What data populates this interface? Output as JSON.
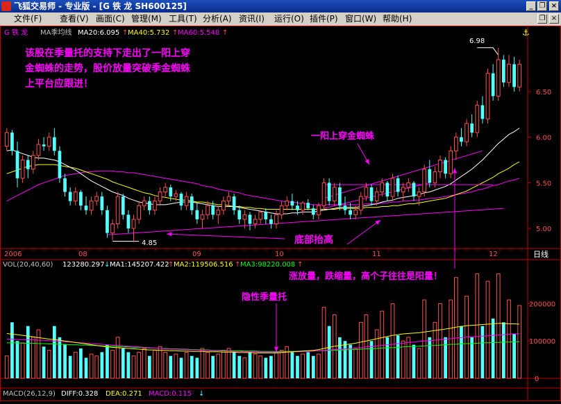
{
  "window": {
    "title": "飞狐交易师 - 专业版 - [G 铁 龙 SH600125]",
    "minimize": "_",
    "restore": "❐",
    "close": "×"
  },
  "menu": {
    "items": [
      "文件(F)",
      "查看(V)",
      "画面(C)",
      "管理(M)",
      "工具(T)",
      "分析(A)",
      "资讯(I)",
      "运行(O)",
      "插件(P)",
      "窗口(W)",
      "帮助(H)"
    ],
    "restore": "❐",
    "close": "×"
  },
  "price_header": {
    "stock": "G 铁   龙",
    "indicator": "MA季均线",
    "ma20": "MA20:6.095",
    "ma40": "MA40:5.732",
    "ma60": "MA60:5.548",
    "arrow": "↑"
  },
  "colors": {
    "up": "#ff5050",
    "down": "#54ffff",
    "ma20": "#ffffff",
    "ma40": "#ffff00",
    "ma60": "#ff00ff",
    "annotation": "#ff00ff",
    "axis": "#c00000",
    "vol_ma3": "#00ff00"
  },
  "annotations": {
    "main_text": [
      "该股在季量托的支持下走出了一阳上穿",
      "金蜘蛛的走势，股价放量突破季金蜘蛛",
      "上平台应跟进！"
    ],
    "one_yang": "一阳上穿金蜘蛛",
    "bottom_rise": "底部抬高",
    "vol_text": "涨放量，跌缩量，高个子往往是阳量！",
    "hidden_tuo": "隐性季量托"
  },
  "price_labels": {
    "high": "6.98",
    "low": "4.85"
  },
  "time_axis": {
    "labels": [
      "2006",
      "08",
      "09",
      "10",
      "11",
      "12"
    ],
    "period": "日线"
  },
  "volume_header": {
    "label": "VOL(20,40,60)",
    "value": "123280.297",
    "ma1": "MA1:145207.422",
    "ma2": "MA2:119506.516",
    "ma3": "MA3:98220.008",
    "down_arrow": "↓",
    "up_arrow": "↑"
  },
  "macd_header": {
    "label": "MACD(26,12,9)",
    "diff": "DIFF:0.328",
    "dea": "DEA:0.271",
    "macd": "MACD:0.115",
    "arrow": "↓"
  },
  "chart_data": {
    "type": "candlestick",
    "price_ticks": [
      5.0,
      5.5,
      6.0,
      6.5
    ],
    "price_ylim": [
      4.78,
      7.1
    ],
    "volume_ticks": [
      0,
      100000,
      200000
    ],
    "volume_tick_labels": [
      "0",
      "100000",
      "200000"
    ],
    "volume_ylim": [
      0,
      290000
    ],
    "ohlc": [
      [
        5.9,
        6.1,
        5.85,
        6.05
      ],
      [
        6.05,
        6.08,
        5.8,
        5.85
      ],
      [
        5.85,
        5.95,
        5.45,
        5.55
      ],
      [
        5.55,
        5.8,
        5.5,
        5.75
      ],
      [
        5.75,
        5.8,
        5.55,
        5.65
      ],
      [
        5.65,
        5.85,
        5.6,
        5.8
      ],
      [
        5.8,
        5.98,
        5.75,
        5.92
      ],
      [
        5.92,
        6.0,
        5.85,
        5.9
      ],
      [
        5.9,
        6.05,
        5.85,
        6.0
      ],
      [
        6.0,
        6.1,
        5.8,
        5.85
      ],
      [
        5.85,
        5.9,
        5.5,
        5.55
      ],
      [
        5.55,
        5.6,
        5.35,
        5.4
      ],
      [
        5.4,
        5.45,
        5.25,
        5.3
      ],
      [
        5.3,
        5.45,
        5.25,
        5.4
      ],
      [
        5.4,
        5.42,
        5.2,
        5.25
      ],
      [
        5.25,
        5.35,
        5.15,
        5.2
      ],
      [
        5.2,
        5.35,
        5.15,
        5.3
      ],
      [
        5.3,
        5.4,
        5.25,
        5.35
      ],
      [
        5.35,
        5.4,
        5.15,
        5.2
      ],
      [
        5.2,
        5.25,
        4.9,
        4.95
      ],
      [
        4.95,
        5.1,
        4.87,
        5.05
      ],
      [
        5.05,
        5.4,
        5.0,
        5.35
      ],
      [
        5.35,
        5.38,
        5.1,
        5.15
      ],
      [
        5.15,
        5.2,
        4.95,
        5.0
      ],
      [
        5.0,
        5.15,
        4.85,
        5.1
      ],
      [
        5.1,
        5.3,
        5.05,
        5.25
      ],
      [
        5.25,
        5.35,
        5.2,
        5.3
      ],
      [
        5.3,
        5.35,
        5.15,
        5.2
      ],
      [
        5.2,
        5.35,
        5.15,
        5.3
      ],
      [
        5.3,
        5.45,
        5.25,
        5.4
      ],
      [
        5.4,
        5.5,
        5.35,
        5.45
      ],
      [
        5.45,
        5.48,
        5.3,
        5.35
      ],
      [
        5.35,
        5.42,
        5.3,
        5.38
      ],
      [
        5.38,
        5.4,
        5.2,
        5.25
      ],
      [
        5.25,
        5.4,
        5.2,
        5.35
      ],
      [
        5.35,
        5.38,
        5.15,
        5.2
      ],
      [
        5.2,
        5.28,
        5.05,
        5.1
      ],
      [
        5.1,
        5.2,
        5.0,
        5.15
      ],
      [
        5.15,
        5.3,
        5.1,
        5.25
      ],
      [
        5.25,
        5.3,
        5.1,
        5.15
      ],
      [
        5.15,
        5.25,
        5.05,
        5.2
      ],
      [
        5.2,
        5.35,
        5.15,
        5.3
      ],
      [
        5.3,
        5.4,
        5.25,
        5.35
      ],
      [
        5.35,
        5.38,
        5.15,
        5.2
      ],
      [
        5.2,
        5.25,
        5.05,
        5.1
      ],
      [
        5.1,
        5.2,
        5.0,
        5.15
      ],
      [
        5.15,
        5.18,
        4.98,
        5.05
      ],
      [
        5.05,
        5.15,
        5.0,
        5.1
      ],
      [
        5.1,
        5.2,
        5.05,
        5.18
      ],
      [
        5.18,
        5.22,
        5.05,
        5.1
      ],
      [
        5.1,
        5.15,
        5.0,
        5.05
      ],
      [
        5.05,
        5.2,
        5.0,
        5.15
      ],
      [
        5.15,
        5.3,
        5.1,
        5.25
      ],
      [
        5.25,
        5.35,
        5.2,
        5.3
      ],
      [
        5.3,
        5.38,
        5.2,
        5.25
      ],
      [
        5.25,
        5.3,
        5.15,
        5.2
      ],
      [
        5.2,
        5.3,
        5.15,
        5.28
      ],
      [
        5.28,
        5.32,
        5.2,
        5.22
      ],
      [
        5.22,
        5.26,
        5.1,
        5.15
      ],
      [
        5.15,
        5.28,
        5.1,
        5.25
      ],
      [
        5.25,
        5.55,
        5.2,
        5.5
      ],
      [
        5.5,
        5.55,
        5.25,
        5.3
      ],
      [
        5.3,
        5.5,
        5.25,
        5.45
      ],
      [
        5.45,
        5.5,
        5.2,
        5.25
      ],
      [
        5.25,
        5.35,
        5.15,
        5.2
      ],
      [
        5.2,
        5.28,
        5.1,
        5.15
      ],
      [
        5.15,
        5.25,
        5.1,
        5.2
      ],
      [
        5.2,
        5.4,
        5.15,
        5.35
      ],
      [
        5.35,
        5.5,
        5.3,
        5.45
      ],
      [
        5.45,
        5.48,
        5.25,
        5.3
      ],
      [
        5.3,
        5.45,
        5.25,
        5.4
      ],
      [
        5.4,
        5.55,
        5.35,
        5.5
      ],
      [
        5.5,
        5.52,
        5.3,
        5.35
      ],
      [
        5.35,
        5.6,
        5.3,
        5.55
      ],
      [
        5.55,
        5.58,
        5.35,
        5.4
      ],
      [
        5.4,
        5.5,
        5.3,
        5.45
      ],
      [
        5.45,
        5.55,
        5.4,
        5.5
      ],
      [
        5.5,
        5.52,
        5.3,
        5.35
      ],
      [
        5.35,
        5.45,
        5.25,
        5.4
      ],
      [
        5.4,
        5.7,
        5.35,
        5.65
      ],
      [
        5.65,
        5.75,
        5.45,
        5.5
      ],
      [
        5.5,
        5.68,
        5.45,
        5.62
      ],
      [
        5.62,
        5.8,
        5.55,
        5.75
      ],
      [
        5.75,
        5.78,
        5.55,
        5.6
      ],
      [
        5.6,
        5.9,
        5.55,
        5.85
      ],
      [
        5.85,
        6.05,
        5.75,
        6.0
      ],
      [
        6.0,
        6.1,
        5.9,
        5.95
      ],
      [
        5.95,
        6.2,
        5.9,
        6.15
      ],
      [
        6.15,
        6.25,
        6.0,
        6.05
      ],
      [
        6.05,
        6.4,
        6.0,
        6.35
      ],
      [
        6.35,
        6.45,
        6.15,
        6.2
      ],
      [
        6.2,
        6.75,
        6.15,
        6.7
      ],
      [
        6.7,
        6.8,
        6.4,
        6.45
      ],
      [
        6.45,
        6.98,
        6.4,
        6.85
      ],
      [
        6.85,
        6.9,
        6.55,
        6.6
      ],
      [
        6.6,
        6.9,
        6.55,
        6.8
      ],
      [
        6.8,
        6.88,
        6.5,
        6.55
      ],
      [
        6.55,
        6.85,
        6.5,
        6.8
      ]
    ],
    "ma20": [
      5.85,
      5.86,
      5.84,
      5.82,
      5.8,
      5.78,
      5.77,
      5.77,
      5.76,
      5.75,
      5.73,
      5.7,
      5.67,
      5.64,
      5.6,
      5.56,
      5.52,
      5.49,
      5.46,
      5.43,
      5.4,
      5.38,
      5.36,
      5.33,
      5.31,
      5.29,
      5.28,
      5.27,
      5.26,
      5.26,
      5.26,
      5.27,
      5.28,
      5.29,
      5.29,
      5.29,
      5.28,
      5.27,
      5.26,
      5.25,
      5.24,
      5.24,
      5.24,
      5.24,
      5.23,
      5.22,
      5.21,
      5.2,
      5.19,
      5.18,
      5.17,
      5.16,
      5.16,
      5.16,
      5.17,
      5.17,
      5.18,
      5.18,
      5.18,
      5.19,
      5.2,
      5.21,
      5.22,
      5.23,
      5.23,
      5.23,
      5.23,
      5.24,
      5.25,
      5.26,
      5.27,
      5.29,
      5.3,
      5.31,
      5.33,
      5.34,
      5.35,
      5.36,
      5.37,
      5.39,
      5.4,
      5.42,
      5.44,
      5.46,
      5.49,
      5.53,
      5.57,
      5.61,
      5.65,
      5.7,
      5.75,
      5.81,
      5.87,
      5.93,
      5.98,
      6.03,
      6.06,
      6.1
    ],
    "ma40": [
      5.6,
      5.62,
      5.64,
      5.66,
      5.68,
      5.69,
      5.7,
      5.7,
      5.7,
      5.7,
      5.69,
      5.68,
      5.67,
      5.66,
      5.64,
      5.62,
      5.6,
      5.58,
      5.56,
      5.54,
      5.51,
      5.49,
      5.47,
      5.45,
      5.43,
      5.41,
      5.39,
      5.38,
      5.36,
      5.35,
      5.34,
      5.33,
      5.32,
      5.31,
      5.31,
      5.3,
      5.29,
      5.29,
      5.28,
      5.27,
      5.26,
      5.26,
      5.25,
      5.24,
      5.24,
      5.23,
      5.23,
      5.22,
      5.22,
      5.21,
      5.21,
      5.21,
      5.21,
      5.21,
      5.21,
      5.21,
      5.21,
      5.21,
      5.21,
      5.21,
      5.21,
      5.21,
      5.21,
      5.22,
      5.22,
      5.22,
      5.22,
      5.22,
      5.23,
      5.23,
      5.23,
      5.24,
      5.24,
      5.25,
      5.25,
      5.26,
      5.27,
      5.27,
      5.28,
      5.29,
      5.3,
      5.31,
      5.32,
      5.33,
      5.35,
      5.37,
      5.39,
      5.41,
      5.44,
      5.47,
      5.5,
      5.53,
      5.56,
      5.6,
      5.63,
      5.66,
      5.7,
      5.73
    ],
    "ma60": [
      5.3,
      5.33,
      5.36,
      5.39,
      5.42,
      5.45,
      5.48,
      5.5,
      5.52,
      5.54,
      5.56,
      5.58,
      5.59,
      5.6,
      5.61,
      5.62,
      5.62,
      5.63,
      5.63,
      5.63,
      5.63,
      5.62,
      5.62,
      5.61,
      5.61,
      5.6,
      5.59,
      5.58,
      5.57,
      5.56,
      5.55,
      5.54,
      5.53,
      5.52,
      5.51,
      5.5,
      5.49,
      5.47,
      5.46,
      5.45,
      5.43,
      5.42,
      5.41,
      5.4,
      5.39,
      5.37,
      5.36,
      5.35,
      5.34,
      5.33,
      5.32,
      5.31,
      5.3,
      5.29,
      5.29,
      5.28,
      5.27,
      5.27,
      5.26,
      5.26,
      5.26,
      5.26,
      5.26,
      5.26,
      5.26,
      5.26,
      5.26,
      5.26,
      5.27,
      5.27,
      5.27,
      5.28,
      5.28,
      5.29,
      5.29,
      5.3,
      5.3,
      5.31,
      5.31,
      5.32,
      5.33,
      5.33,
      5.34,
      5.35,
      5.36,
      5.37,
      5.38,
      5.39,
      5.4,
      5.42,
      5.43,
      5.45,
      5.47,
      5.48,
      5.5,
      5.52,
      5.53,
      5.55
    ],
    "volume": [
      60000,
      150000,
      100000,
      95000,
      140000,
      110000,
      130000,
      85000,
      75000,
      140000,
      110000,
      90000,
      60000,
      70000,
      80000,
      55000,
      65000,
      60000,
      70000,
      90000,
      75000,
      110000,
      80000,
      70000,
      60000,
      70000,
      80000,
      60000,
      75000,
      85000,
      70000,
      60000,
      65000,
      55000,
      70000,
      60000,
      55000,
      80000,
      70000,
      60000,
      65000,
      75000,
      80000,
      70000,
      60000,
      55000,
      70000,
      65000,
      60000,
      55000,
      60000,
      70000,
      75000,
      85000,
      70000,
      60000,
      65000,
      70000,
      60000,
      65000,
      190000,
      140000,
      170000,
      110000,
      100000,
      90000,
      80000,
      150000,
      170000,
      100000,
      130000,
      180000,
      110000,
      200000,
      115000,
      100000,
      110000,
      90000,
      80000,
      210000,
      110000,
      150000,
      200000,
      110000,
      210000,
      270000,
      140000,
      220000,
      110000,
      280000,
      140000,
      260000,
      160000,
      280000,
      150000,
      210000,
      120000,
      195000
    ],
    "vol_ma1": [
      120000,
      118000,
      117000,
      115000,
      113000,
      111000,
      109000,
      107000,
      105000,
      104000,
      102000,
      100000,
      98000,
      96000,
      94000,
      92000,
      90000,
      88000,
      86000,
      84000,
      83000,
      82000,
      81000,
      80000,
      79000,
      78000,
      77000,
      76000,
      76000,
      75000,
      75000,
      74000,
      74000,
      73000,
      73000,
      72000,
      72000,
      72000,
      71000,
      71000,
      71000,
      70000,
      70000,
      70000,
      69000,
      69000,
      69000,
      68000,
      68000,
      68000,
      68000,
      68000,
      69000,
      70000,
      71000,
      72000,
      73000,
      74000,
      75000,
      77000,
      80000,
      83000,
      86000,
      88000,
      90000,
      92000,
      94000,
      97000,
      100000,
      103000,
      106000,
      109000,
      112000,
      115000,
      117000,
      119000,
      120000,
      121000,
      122000,
      124000,
      126000,
      128000,
      130000,
      132000,
      134000,
      137000,
      139000,
      141000,
      142000,
      143000,
      144000,
      145000,
      146000,
      147000,
      147000,
      146000,
      146000,
      145000
    ],
    "vol_ma2": [
      105000,
      105000,
      104000,
      104000,
      103000,
      103000,
      102000,
      102000,
      101000,
      100000,
      99000,
      98000,
      97000,
      96000,
      95000,
      94000,
      93000,
      92000,
      91000,
      90000,
      89000,
      88000,
      87000,
      86000,
      85000,
      84000,
      83000,
      82000,
      81000,
      80000,
      79000,
      78000,
      78000,
      77000,
      77000,
      76000,
      76000,
      75000,
      75000,
      74000,
      74000,
      73000,
      73000,
      72000,
      72000,
      71000,
      71000,
      71000,
      70000,
      70000,
      70000,
      70000,
      70000,
      71000,
      71000,
      71000,
      72000,
      72000,
      73000,
      74000,
      75000,
      76000,
      77000,
      78000,
      79000,
      80000,
      81000,
      82000,
      84000,
      85000,
      87000,
      88000,
      90000,
      91000,
      93000,
      94000,
      96000,
      97000,
      99000,
      100000,
      101000,
      102000,
      104000,
      105000,
      106000,
      108000,
      109000,
      110000,
      111000,
      112000,
      113000,
      114000,
      115000,
      116000,
      117000,
      118000,
      119000,
      119500
    ],
    "vol_ma3": [
      95000,
      95000,
      95000,
      94000,
      94000,
      94000,
      93000,
      93000,
      92000,
      92000,
      91000,
      91000,
      90000,
      90000,
      89000,
      89000,
      88000,
      88000,
      87000,
      86000,
      86000,
      85000,
      85000,
      84000,
      83000,
      83000,
      82000,
      81000,
      81000,
      80000,
      80000,
      79000,
      79000,
      78000,
      78000,
      77000,
      77000,
      76000,
      76000,
      75000,
      75000,
      75000,
      74000,
      74000,
      74000,
      73000,
      73000,
      73000,
      72000,
      72000,
      72000,
      72000,
      72000,
      72000,
      72000,
      72000,
      73000,
      73000,
      73000,
      74000,
      74000,
      75000,
      75000,
      76000,
      76000,
      77000,
      77000,
      78000,
      79000,
      79000,
      80000,
      81000,
      82000,
      82000,
      83000,
      84000,
      85000,
      85000,
      86000,
      87000,
      88000,
      88000,
      89000,
      90000,
      91000,
      91000,
      92000,
      93000,
      93000,
      94000,
      95000,
      95000,
      96000,
      96000,
      97000,
      97000,
      98000,
      98200
    ]
  }
}
